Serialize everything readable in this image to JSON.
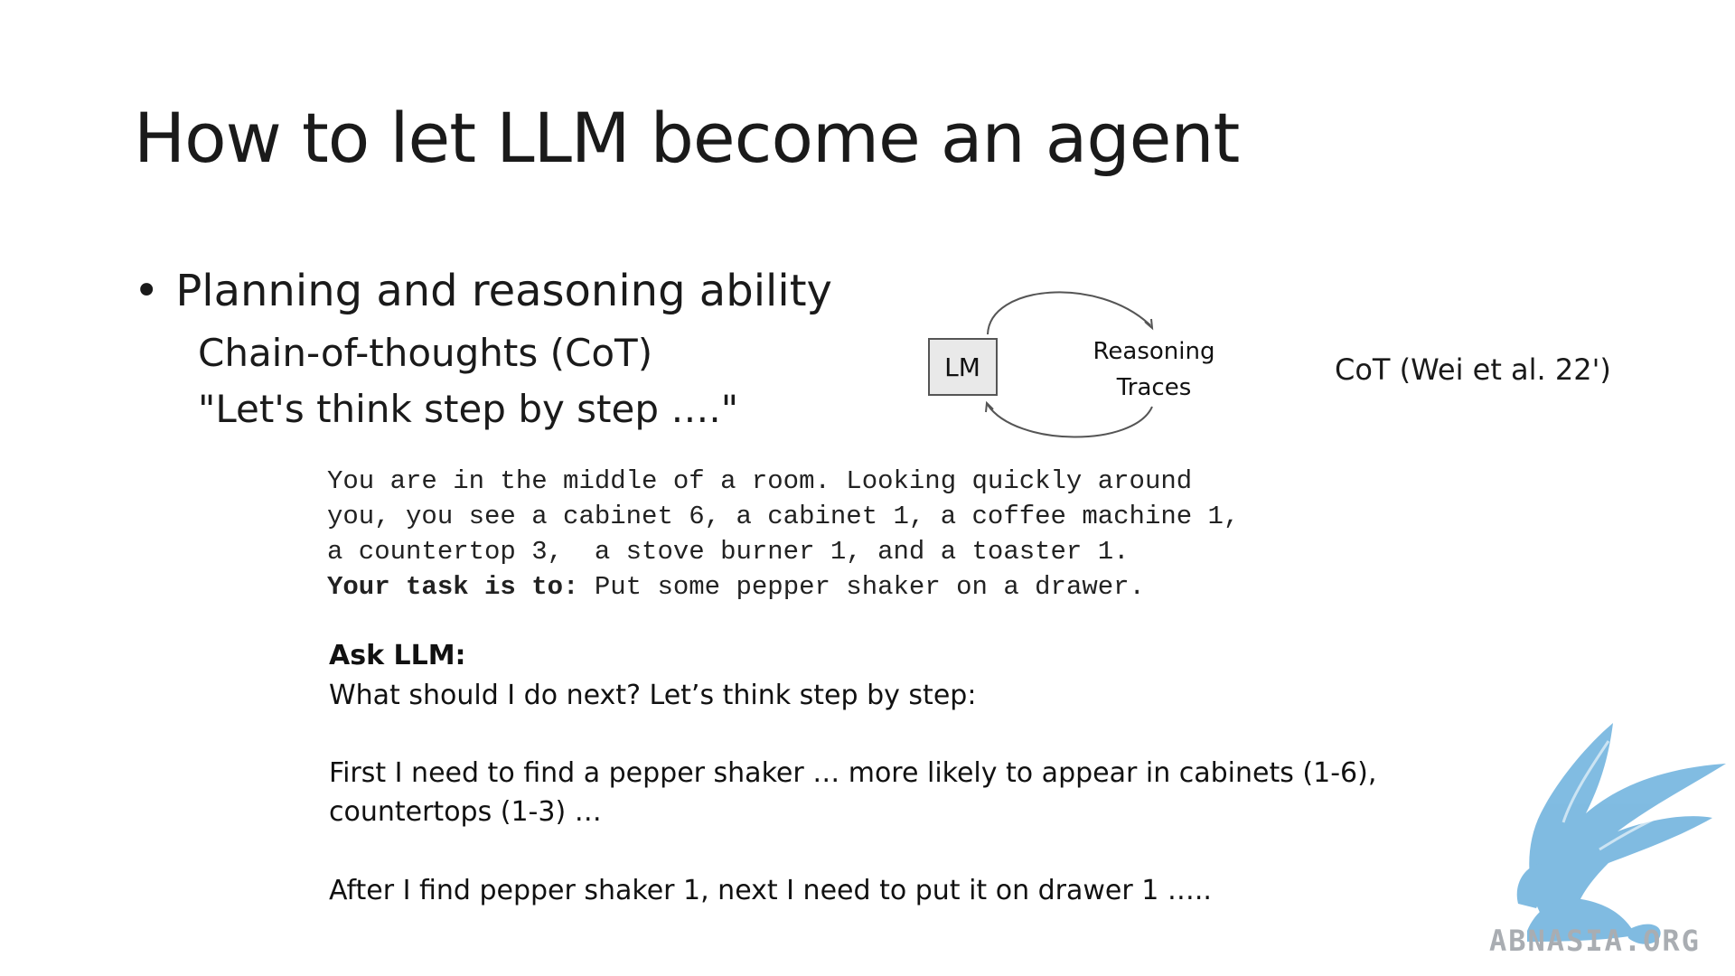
{
  "slide": {
    "title": "How to let LLM become an agent",
    "bullet": {
      "symbol": "•",
      "text": "Planning and reasoning ability"
    },
    "sub_lines": [
      "Chain-of-thoughts (CoT)",
      "\"Let's think step by step ….\""
    ]
  },
  "diagram": {
    "lm_label": "LM",
    "traces_line1": "Reasoning",
    "traces_line2": "Traces",
    "citation": "CoT (Wei et al. 22')"
  },
  "prompt": {
    "lines": [
      "You are in the middle of a room. Looking quickly around",
      "you, you see a cabinet 6, a cabinet 1, a coffee machine 1,",
      "a countertop 3,  a stove burner 1, and a toaster 1."
    ],
    "task_label": "Your task is to:",
    "task_text": " Put some pepper shaker on a drawer."
  },
  "ask": {
    "heading": "Ask LLM:",
    "question": "What should I do next? Let’s think step by step:",
    "answer1_line1": "First I need to find a pepper shaker … more likely to appear in cabinets (1-6),",
    "answer1_line2": "countertops (1-3) …",
    "answer2": "After I find pepper shaker 1, next I need to put it on drawer 1 ….."
  },
  "watermark": {
    "text": "ABNASIA.ORG",
    "icon": "griffin-logo-icon",
    "color": "#7ab8e0"
  }
}
